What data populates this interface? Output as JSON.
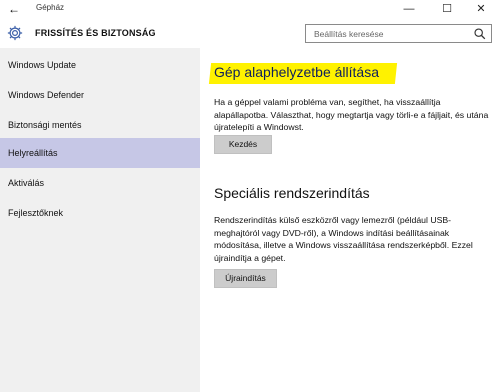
{
  "window": {
    "title": "Gépház",
    "back_icon": "←",
    "minimize_icon": "—",
    "maximize_icon": "☐",
    "close_icon": "✕"
  },
  "header": {
    "title": "FRISSÍTÉS ÉS BIZTONSÁG",
    "icon": "gear-icon"
  },
  "search": {
    "placeholder": "Beállítás keresése",
    "icon": "search-icon"
  },
  "sidebar": {
    "items": [
      {
        "label": "Windows Update",
        "active": false
      },
      {
        "label": "Windows Defender",
        "active": false
      },
      {
        "label": "Biztonsági mentés",
        "active": false
      },
      {
        "label": "Helyreállítás",
        "active": true
      },
      {
        "label": "Aktiválás",
        "active": false
      },
      {
        "label": "Fejlesztőknek",
        "active": false
      }
    ]
  },
  "main": {
    "reset_section": {
      "title": "Gép alaphelyzetbe állítása",
      "description": "Ha a géppel valami probléma van, segíthet, ha visszaállítja alapállapotba. Választhat, hogy megtartja vagy törli-e a fájljait, és utána újratelepíti a Windowst.",
      "button_label": "Kezdés"
    },
    "advanced_section": {
      "title": "Speciális rendszerindítás",
      "description": "Rendszerindítás külső eszközről vagy lemezről (például USB-meghajtóról vagy DVD-ről), a Windows indítási beállításainak módosítása, illetve a Windows visszaállítása rendszerképből. Ezzel újraindítja a gépet.",
      "button_label": "Újraindítás"
    }
  },
  "colors": {
    "sidebar_bg": "#f0f0f0",
    "active_item_bg": "#c6c7e6",
    "highlight": "#fff200",
    "button_bg": "#cccccc"
  }
}
